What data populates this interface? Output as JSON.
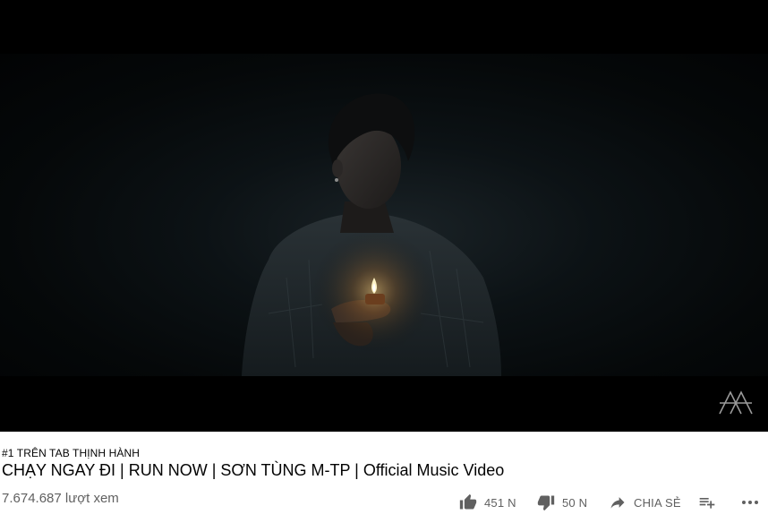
{
  "video": {
    "hashtag": "#1 TRÊN TAB THỊNH HÀNH",
    "title": "CHẠY NGAY ĐI | RUN NOW | SƠN TÙNG M-TP | Official Music Video",
    "views": "7.674.687 lượt xem"
  },
  "actions": {
    "like_count": "451 N",
    "dislike_count": "50 N",
    "share_label": "CHIA SẺ",
    "like_icon": "thumbs-up-icon",
    "dislike_icon": "thumbs-down-icon",
    "share_icon": "share-arrow-icon",
    "save_icon": "add-to-playlist-icon",
    "more_icon": "more-horiz-icon"
  },
  "colors": {
    "text_primary": "#030303",
    "text_secondary": "#606060",
    "player_bg": "#000000"
  }
}
